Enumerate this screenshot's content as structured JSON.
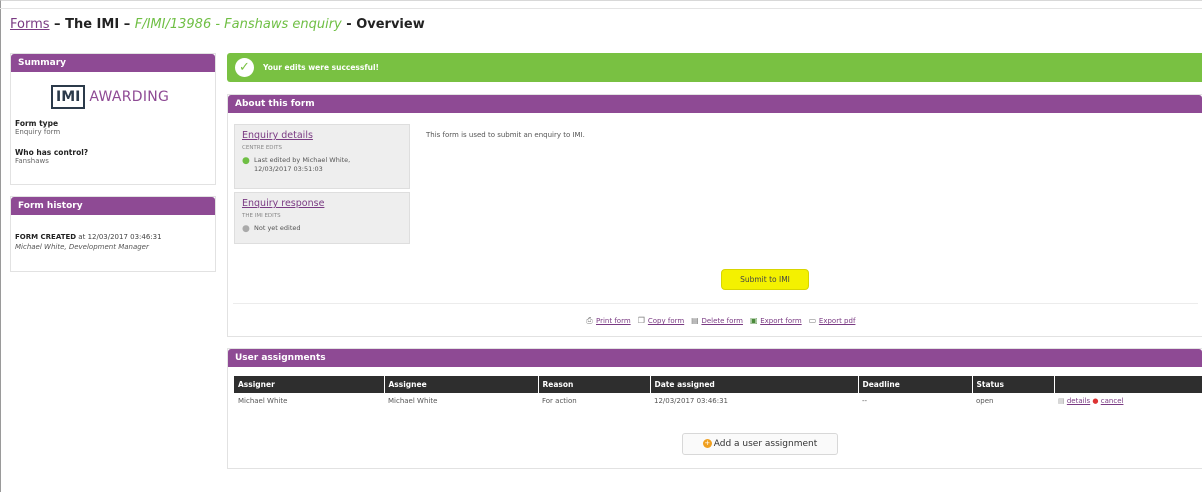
{
  "header": {
    "breadcrumb_link": "Forms",
    "sep1": " – ",
    "org": "The IMI",
    "sep2": " – ",
    "form_ref": "F/IMI/13986 - Fanshaws enquiry",
    "sep3": " - ",
    "page": "Overview"
  },
  "summary": {
    "bar_title": "Summary",
    "logo_box": "IMI",
    "logo_word": "AWARDING",
    "form_type_label": "Form type",
    "form_type_value": "Enquiry form",
    "control_label": "Who has control?",
    "control_value": "Fanshaws"
  },
  "history": {
    "bar_title": "Form history",
    "event": "FORM CREATED",
    "event_at": " at 12/03/2017 03:46:31",
    "actor": "Michael White, Development Manager"
  },
  "banner": {
    "message": "Your edits were successful!"
  },
  "about": {
    "bar_title": "About this form",
    "description": "This form is used to submit an enquiry to IMI.",
    "sections": [
      {
        "title": "Enquiry details",
        "owner": "CENTRE EDITS",
        "status_line1": "Last edited by Michael White,",
        "status_line2": "12/03/2017 03:51:03"
      },
      {
        "title": "Enquiry response",
        "owner": "THE IMI EDITS",
        "status_line1": "Not yet edited",
        "status_line2": ""
      }
    ],
    "submit_label": "Submit to IMI",
    "actions": {
      "print": "Print form",
      "copy": "Copy form",
      "delete": "Delete form",
      "export": "Export form",
      "export_pdf": "Export pdf"
    }
  },
  "assignments": {
    "bar_title": "User assignments",
    "columns": [
      "Assigner",
      "Assignee",
      "Reason",
      "Date assigned",
      "Deadline",
      "Status",
      ""
    ],
    "rows": [
      {
        "assigner": "Michael White",
        "assignee": "Michael White",
        "reason": "For action",
        "date": "12/03/2017 03:46:31",
        "deadline": "--",
        "status": "open",
        "details": "details",
        "cancel": "cancel"
      }
    ],
    "add_label": "Add a user assignment"
  },
  "colors": {
    "brand_purple": "#8e4a94",
    "success_green": "#79c142",
    "highlight_yellow": "#f4f100"
  }
}
